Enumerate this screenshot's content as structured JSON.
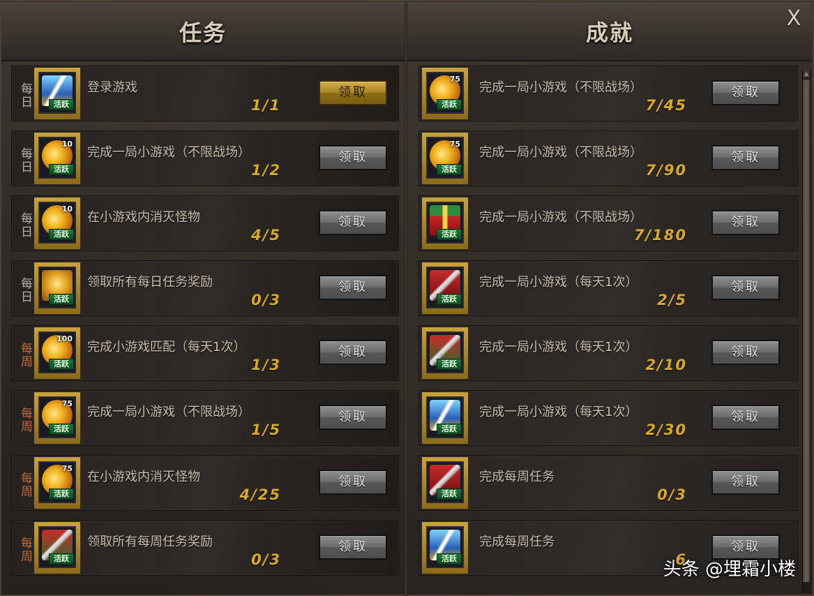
{
  "window": {
    "tabs": [
      "任务",
      "成就"
    ],
    "close_label": "X"
  },
  "tasks": [
    {
      "period": "每日",
      "period_type": "daily",
      "icon": "lightning",
      "icon_num": "",
      "badge": "活跃",
      "name": "登录游戏",
      "progress": "1/1",
      "claim": "领取",
      "claimable": true
    },
    {
      "period": "每日",
      "period_type": "daily",
      "icon": "coin",
      "icon_num": "10",
      "badge": "活跃",
      "name": "完成一局小游戏（不限战场）",
      "progress": "1/2",
      "claim": "领取",
      "claimable": false
    },
    {
      "period": "每日",
      "period_type": "daily",
      "icon": "coin",
      "icon_num": "10",
      "badge": "活跃",
      "name": "在小游戏内消灭怪物",
      "progress": "4/5",
      "claim": "领取",
      "claimable": false
    },
    {
      "period": "每日",
      "period_type": "daily",
      "icon": "coin-gold",
      "icon_num": "",
      "badge": "活跃",
      "name": "领取所有每日任务奖励",
      "progress": "0/3",
      "claim": "领取",
      "claimable": false
    },
    {
      "period": "每周",
      "period_type": "weekly",
      "icon": "coin",
      "icon_num": "100",
      "badge": "活跃",
      "name": "完成小游戏匹配（每天1次）",
      "progress": "1/3",
      "claim": "领取",
      "claimable": false
    },
    {
      "period": "每周",
      "period_type": "weekly",
      "icon": "coin",
      "icon_num": "75",
      "badge": "活跃",
      "name": "完成一局小游戏（不限战场）",
      "progress": "1/5",
      "claim": "领取",
      "claimable": false
    },
    {
      "period": "每周",
      "period_type": "weekly",
      "icon": "coin",
      "icon_num": "75",
      "badge": "活跃",
      "name": "在小游戏内消灭怪物",
      "progress": "4/25",
      "claim": "领取",
      "claimable": false
    },
    {
      "period": "每周",
      "period_type": "weekly",
      "icon": "sword-green",
      "icon_num": "",
      "badge": "活跃",
      "name": "领取所有每周任务奖励",
      "progress": "0/3",
      "claim": "领取",
      "claimable": false
    }
  ],
  "achievements": [
    {
      "icon": "coin",
      "icon_num": "75",
      "badge": "活跃",
      "name": "完成一局小游戏（不限战场）",
      "progress": "7/45",
      "claim": "领取"
    },
    {
      "icon": "coin",
      "icon_num": "75",
      "badge": "活跃",
      "name": "完成一局小游戏（不限战场）",
      "progress": "7/90",
      "claim": "领取"
    },
    {
      "icon": "gift",
      "icon_num": "",
      "badge": "活跃",
      "name": "完成一局小游戏（不限战场）",
      "progress": "7/180",
      "claim": "领取"
    },
    {
      "icon": "sword",
      "icon_num": "",
      "badge": "活跃",
      "name": "完成一局小游戏（每天1次）",
      "progress": "2/5",
      "claim": "领取"
    },
    {
      "icon": "sword-green",
      "icon_num": "",
      "badge": "活跃",
      "name": "完成一局小游戏（每天1次）",
      "progress": "2/10",
      "claim": "领取"
    },
    {
      "icon": "lightning",
      "icon_num": "",
      "badge": "活跃",
      "name": "完成一局小游戏（每天1次）",
      "progress": "2/30",
      "claim": "领取"
    },
    {
      "icon": "sword",
      "icon_num": "",
      "badge": "活跃",
      "name": "完成每周任务",
      "progress": "0/3",
      "claim": "领取"
    },
    {
      "icon": "lightning",
      "icon_num": "",
      "badge": "活跃",
      "name": "完成每周任务",
      "progress": "6",
      "claim": "领取"
    }
  ],
  "watermark": "头条 @埋霜小楼",
  "colors": {
    "daily_label": "#b9b2a6",
    "weekly_label": "#c76a3a",
    "progress": "#d9a92a",
    "claim_active": "#c9a23a",
    "claim_inactive": "#6c6c6c"
  }
}
